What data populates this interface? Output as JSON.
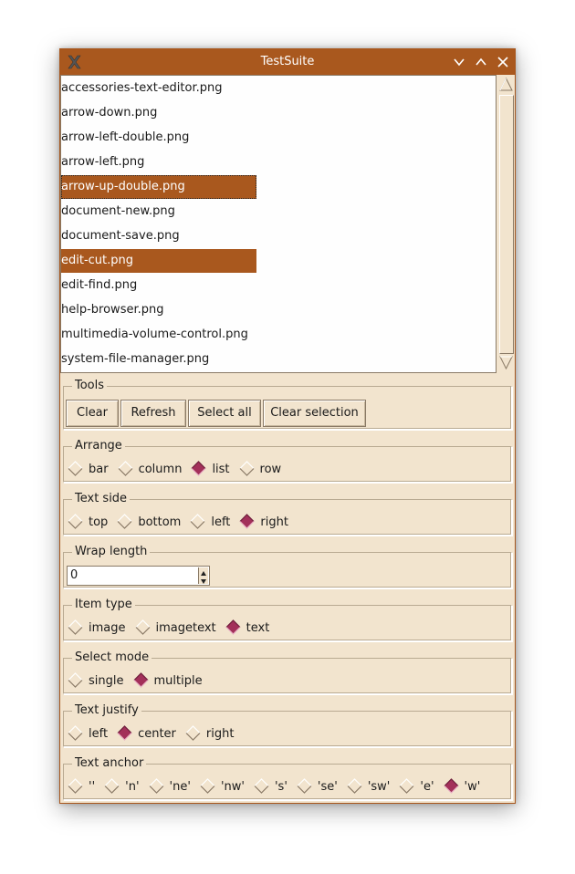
{
  "window": {
    "title": "TestSuite"
  },
  "files": [
    {
      "name": "accessories-text-editor.png",
      "selected": false,
      "focus": false
    },
    {
      "name": "arrow-down.png",
      "selected": false,
      "focus": false
    },
    {
      "name": "arrow-left-double.png",
      "selected": false,
      "focus": false
    },
    {
      "name": "arrow-left.png",
      "selected": false,
      "focus": false
    },
    {
      "name": "arrow-up-double.png",
      "selected": true,
      "focus": true
    },
    {
      "name": "document-new.png",
      "selected": false,
      "focus": false
    },
    {
      "name": "document-save.png",
      "selected": false,
      "focus": false
    },
    {
      "name": "edit-cut.png",
      "selected": true,
      "focus": false
    },
    {
      "name": "edit-find.png",
      "selected": false,
      "focus": false
    },
    {
      "name": "help-browser.png",
      "selected": false,
      "focus": false
    },
    {
      "name": "multimedia-volume-control.png",
      "selected": false,
      "focus": false
    },
    {
      "name": "system-file-manager.png",
      "selected": false,
      "focus": false
    }
  ],
  "tools": {
    "legend": "Tools",
    "buttons": [
      "Clear",
      "Refresh",
      "Select all",
      "Clear selection"
    ]
  },
  "groups": [
    {
      "legend": "Arrange",
      "options": [
        "bar",
        "column",
        "list",
        "row"
      ],
      "selected": 2
    },
    {
      "legend": "Text side",
      "options": [
        "top",
        "bottom",
        "left",
        "right"
      ],
      "selected": 3
    },
    {
      "legend": "Item type",
      "options": [
        "image",
        "imagetext",
        "text"
      ],
      "selected": 2
    },
    {
      "legend": "Select mode",
      "options": [
        "single",
        "multiple"
      ],
      "selected": 1
    },
    {
      "legend": "Text justify",
      "options": [
        "left",
        "center",
        "right"
      ],
      "selected": 1
    },
    {
      "legend": "Text anchor",
      "options": [
        "''",
        "'n'",
        "'ne'",
        "'nw'",
        "'s'",
        "'se'",
        "'sw'",
        "'e'",
        "'w'"
      ],
      "selected": 8
    }
  ],
  "wrap": {
    "legend": "Wrap length",
    "value": "0"
  },
  "colors": {
    "accent": "#a9581e",
    "background": "#f2e4ce",
    "radio_on": "#a3305a"
  }
}
